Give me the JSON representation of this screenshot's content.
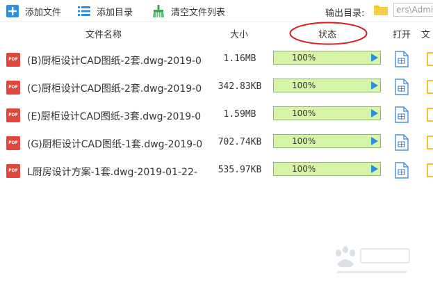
{
  "toolbar": {
    "add_file_label": "添加文件",
    "add_dir_label": "添加目录",
    "clear_label": "清空文件列表",
    "output_dir_label": "输出目录:",
    "output_dir_value": "ers\\Admi"
  },
  "header": {
    "name": "文件名称",
    "size": "大小",
    "status": "状态",
    "open": "打开",
    "folder": "文"
  },
  "files": [
    {
      "name": "(B)厨柜设计CAD图纸-2套.dwg-2019-0",
      "size": "1.16MB",
      "progress_label": "100%",
      "progress": 100
    },
    {
      "name": "(C)厨柜设计CAD图纸-2套.dwg-2019-0",
      "size": "342.83KB",
      "progress_label": "100%",
      "progress": 100
    },
    {
      "name": "(E)厨柜设计CAD图纸-3套.dwg-2019-0",
      "size": "1.59MB",
      "progress_label": "100%",
      "progress": 100
    },
    {
      "name": "(G)厨柜设计CAD图纸-1套.dwg-2019-0",
      "size": "702.74KB",
      "progress_label": "100%",
      "progress": 100
    },
    {
      "name": "L厨房设计方案-1套.dwg-2019-01-22-",
      "size": "535.97KB",
      "progress_label": "100%",
      "progress": 100
    }
  ],
  "file_badge": "PDF",
  "icons": {
    "add_file": "plus-icon",
    "add_dir": "list-icon",
    "clear": "broom-icon",
    "output_folder": "folder-icon",
    "open": "file-open-icon",
    "folder": "folder-icon"
  },
  "colors": {
    "accent_blue": "#2c8fe0",
    "progress_fill": "#d7f5a8",
    "pdf_red": "#e2463c",
    "folder_yellow": "#f5c32c",
    "annotation_red": "#d42020"
  }
}
